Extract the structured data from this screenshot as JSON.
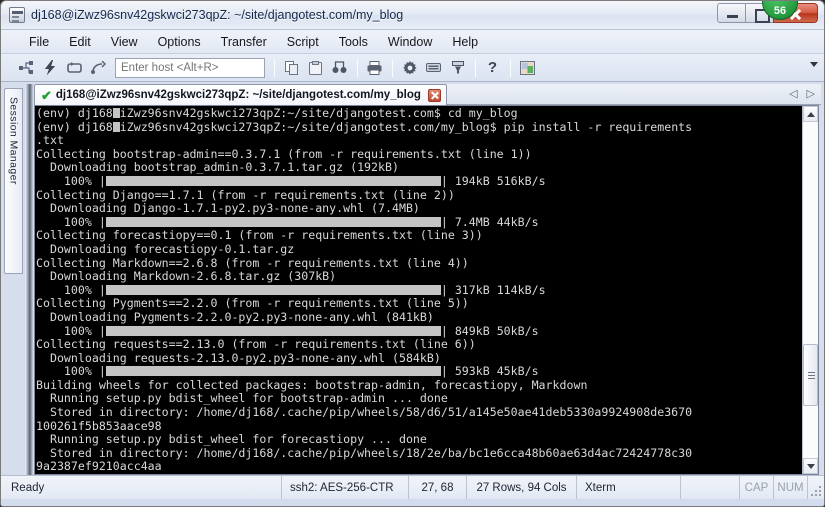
{
  "window": {
    "title": "dj168@iZwz96snv42gskwci273qpZ: ~/site/djangotest.com/my_blog",
    "icon": "securecrt-icon",
    "badge": "56",
    "minimize_label": "Minimize",
    "maximize_label": "Restore",
    "close_label": "Close"
  },
  "menu": {
    "items": [
      {
        "label": "File"
      },
      {
        "label": "Edit"
      },
      {
        "label": "View"
      },
      {
        "label": "Options"
      },
      {
        "label": "Transfer"
      },
      {
        "label": "Script"
      },
      {
        "label": "Tools"
      },
      {
        "label": "Window"
      },
      {
        "label": "Help"
      }
    ]
  },
  "toolbar": {
    "buttons": [
      {
        "name": "new-session-icon",
        "glyph": "⋈"
      },
      {
        "name": "quick-connect-icon",
        "glyph": "⚡"
      },
      {
        "name": "reconnect-icon",
        "glyph": "⟳"
      },
      {
        "name": "disconnect-icon",
        "glyph": "⤬"
      },
      {
        "name": "copy-icon",
        "glyph": "❐"
      },
      {
        "name": "paste-icon",
        "glyph": "📋"
      },
      {
        "name": "find-icon",
        "glyph": "🔍"
      },
      {
        "name": "print-icon",
        "glyph": "🖶"
      },
      {
        "name": "session-options-icon",
        "glyph": "✿"
      },
      {
        "name": "keymap-editor-icon",
        "glyph": "▤"
      },
      {
        "name": "filter-icon",
        "glyph": "⏏"
      },
      {
        "name": "help-icon",
        "glyph": "?"
      },
      {
        "name": "screen-capture-icon",
        "glyph": "▣"
      }
    ],
    "host_input": {
      "value": "",
      "placeholder": "Enter host <Alt+R>"
    },
    "overflow_label": "More toolbar buttons"
  },
  "sidebar": {
    "session_manager_label": "Session Manager"
  },
  "tabstrip": {
    "tabs": [
      {
        "label": "dj168@iZwz96snv42gskwci273qpZ: ~/site/djangotest.com/my_blog",
        "connected_marker": "✔",
        "close_label": "Close tab"
      }
    ],
    "nav_prev": "◁",
    "nav_next": "▷"
  },
  "terminal": {
    "lines": [
      "(env) dj168@iZwz96snv42gskwci273qpZ:~/site/djangotest.com$ cd my_blog",
      "(env) dj168@iZwz96snv42gskwci273qpZ:~/site/djangotest.com/my_blog$ pip install -r requirements",
      ".txt",
      "Collecting bootstrap-admin==0.3.7.1 (from -r requirements.txt (line 1))",
      "  Downloading bootstrap_admin-0.3.7.1.tar.gz (192kB)",
      "    100% |@@@@@@@@@@@@@@@@@@@@@@@@@@@@@@@@@@@@@@@@@@@@@@@@| 194kB 516kB/s",
      "Collecting Django==1.7.1 (from -r requirements.txt (line 2))",
      "  Downloading Django-1.7.1-py2.py3-none-any.whl (7.4MB)",
      "    100% |@@@@@@@@@@@@@@@@@@@@@@@@@@@@@@@@@@@@@@@@@@@@@@@@| 7.4MB 44kB/s",
      "Collecting forecastiopy==0.1 (from -r requirements.txt (line 3))",
      "  Downloading forecastiopy-0.1.tar.gz",
      "Collecting Markdown==2.6.8 (from -r requirements.txt (line 4))",
      "  Downloading Markdown-2.6.8.tar.gz (307kB)",
      "    100% |@@@@@@@@@@@@@@@@@@@@@@@@@@@@@@@@@@@@@@@@@@@@@@@@| 317kB 114kB/s",
      "Collecting Pygments==2.2.0 (from -r requirements.txt (line 5))",
      "  Downloading Pygments-2.2.0-py2.py3-none-any.whl (841kB)",
      "    100% |@@@@@@@@@@@@@@@@@@@@@@@@@@@@@@@@@@@@@@@@@@@@@@@@| 849kB 50kB/s",
      "Collecting requests==2.13.0 (from -r requirements.txt (line 6))",
      "  Downloading requests-2.13.0-py2.py3-none-any.whl (584kB)",
      "    100% |@@@@@@@@@@@@@@@@@@@@@@@@@@@@@@@@@@@@@@@@@@@@@@@@| 593kB 45kB/s",
      "Building wheels for collected packages: bootstrap-admin, forecastiopy, Markdown",
      "  Running setup.py bdist_wheel for bootstrap-admin ... done",
      "  Stored in directory: /home/dj168/.cache/pip/wheels/58/d6/51/a145e50ae41deb5330a9924908de3670",
      "100261f5b853aace98",
      "  Running setup.py bdist_wheel for forecastiopy ... done",
      "  Stored in directory: /home/dj168/.cache/pip/wheels/18/2e/ba/bc1e6cca48b60ae63d4ac72424778c30",
      "9a2387ef9210acc4aa"
    ],
    "foreground_color": "#d8d8d8",
    "background_color": "#000000",
    "progress_fill_color": "#c4c4c4"
  },
  "status_bar": {
    "ready": "Ready",
    "encryption": "ssh2: AES-256-CTR",
    "cursor_position": "27, 68",
    "dimensions": "27 Rows, 94 Cols",
    "emulation": "Xterm",
    "caps_lock": "CAP",
    "num_lock": "NUM"
  }
}
